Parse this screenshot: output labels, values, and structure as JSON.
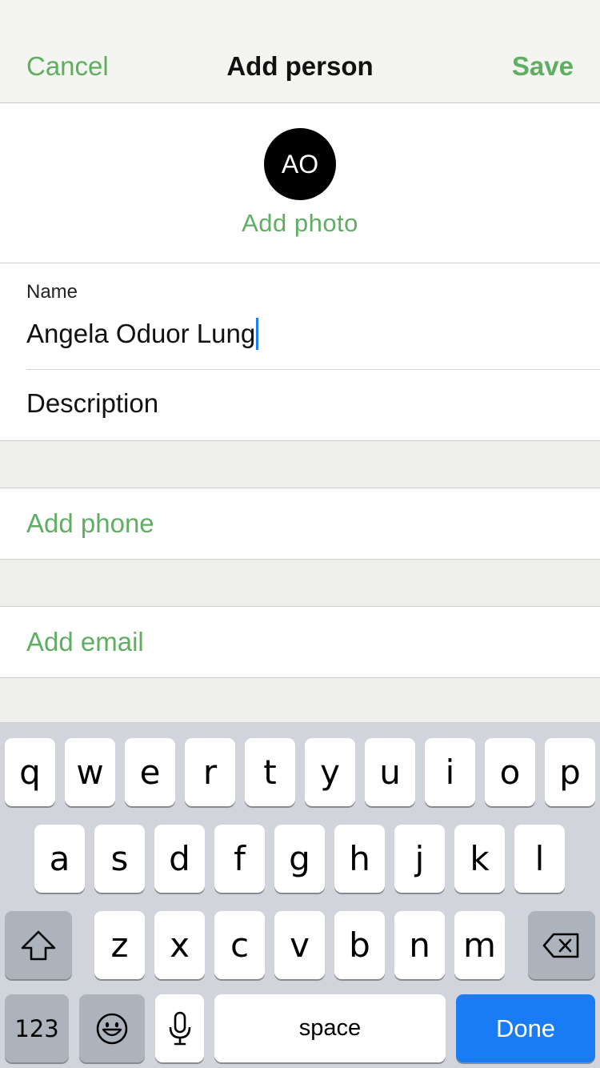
{
  "nav": {
    "cancel": "Cancel",
    "title": "Add person",
    "save": "Save"
  },
  "photo": {
    "initials": "AO",
    "add_label": "Add photo"
  },
  "form": {
    "name_label": "Name",
    "name_value": "Angela Oduor Lung",
    "description_placeholder": "Description"
  },
  "links": {
    "add_phone": "Add phone",
    "add_email": "Add email"
  },
  "keyboard": {
    "row1": [
      "q",
      "w",
      "e",
      "r",
      "t",
      "y",
      "u",
      "i",
      "o",
      "p"
    ],
    "row2": [
      "a",
      "s",
      "d",
      "f",
      "g",
      "h",
      "j",
      "k",
      "l"
    ],
    "row3": [
      "z",
      "x",
      "c",
      "v",
      "b",
      "n",
      "m"
    ],
    "numbers": "123",
    "space": "space",
    "done": "Done"
  },
  "colors": {
    "accent": "#5fae62",
    "caret": "#1b7ef5",
    "done_key": "#1a7cf5",
    "keyboard_bg": "#d1d4da"
  },
  "icons": {
    "shift": "shift-icon",
    "delete": "delete-icon",
    "emoji": "emoji-icon",
    "mic": "microphone-icon"
  }
}
